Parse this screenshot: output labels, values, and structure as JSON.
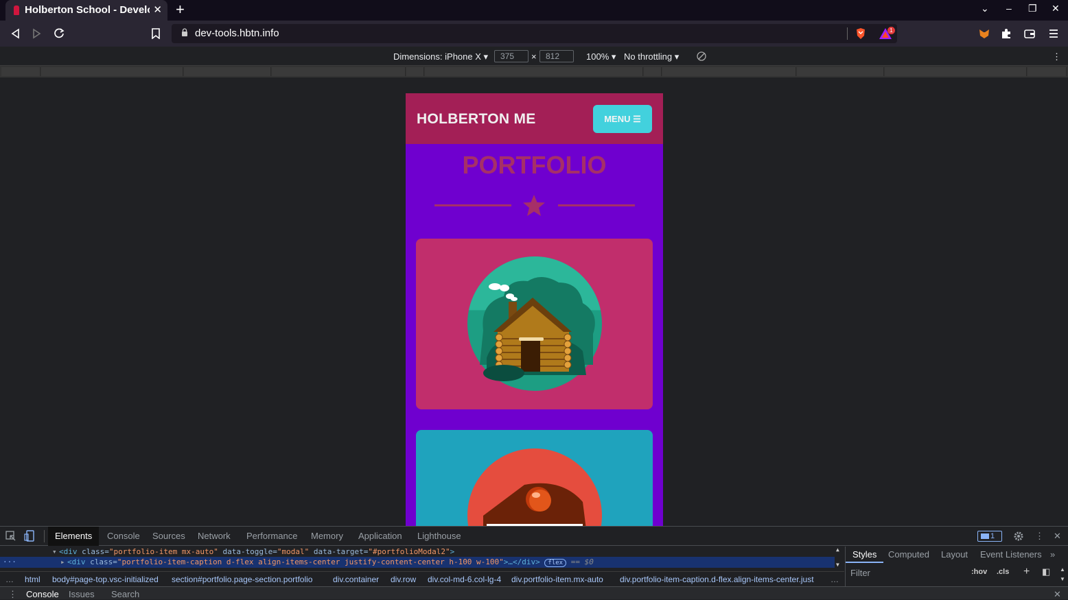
{
  "browser": {
    "tab_title": "Holberton School - Develo",
    "url": "dev-tools.hbtn.info",
    "notification_count": "1"
  },
  "device_toolbar": {
    "dimensions_label": "Dimensions: iPhone X",
    "width": "375",
    "height": "812",
    "times": "×",
    "zoom": "100%",
    "throttling": "No throttling"
  },
  "page": {
    "brand": "HOLBERTON ME",
    "menu_label": "MENU",
    "section_title": "PORTFOLIO"
  },
  "devtools": {
    "tabs": [
      "Elements",
      "Console",
      "Sources",
      "Network",
      "Performance",
      "Memory",
      "Application",
      "Lighthouse"
    ],
    "message_count": "1",
    "code_line1": {
      "open": "<div ",
      "class_attr": "class=",
      "class_val": "\"portfolio-item mx-auto\"",
      "toggle_attr": " data-toggle=",
      "toggle_val": "\"modal\"",
      "target_attr": " data-target=",
      "target_val": "\"#portfolioModal2\"",
      "close": ">"
    },
    "code_line2": {
      "open": "<div ",
      "class_attr": "class=",
      "class_val": "\"portfolio-item-caption d-flex align-items-center justify-content-center h-100 w-100\"",
      "rest": ">…</div>",
      "pill": "flex",
      "eq": "== $0"
    },
    "breadcrumbs": [
      "html",
      "body#page-top.vsc-initialized",
      "section#portfolio.page-section.portfolio",
      "div.container",
      "div.row",
      "div.col-md-6.col-lg-4",
      "div.portfolio-item.mx-auto",
      "div.portfolio-item-caption.d-flex.align-items-center.just"
    ],
    "breadcrumb_more": "…",
    "styles_tabs": [
      "Styles",
      "Computed",
      "Layout",
      "Event Listeners"
    ],
    "filter_placeholder": "Filter",
    "hov": ":hov",
    "cls": ".cls",
    "drawer_tabs": [
      "Console",
      "Issues",
      "Search"
    ]
  },
  "colors": {
    "nav_bg": "#a31f56",
    "page_bg": "#6f00cf",
    "accent": "#42d1dd",
    "card1": "#c12e6c",
    "card2": "#1fa3bd"
  }
}
